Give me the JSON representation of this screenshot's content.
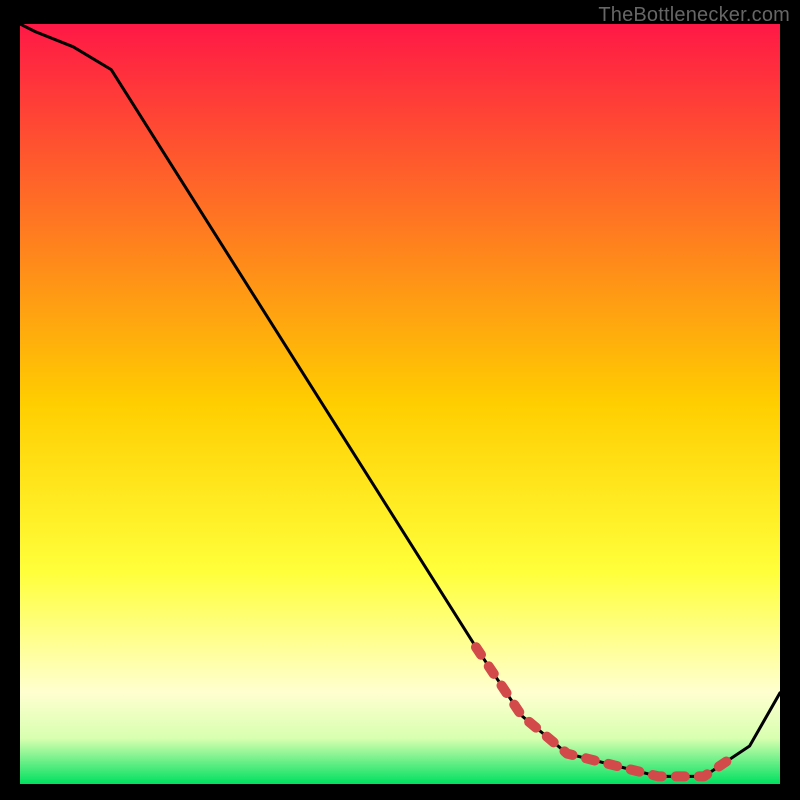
{
  "watermark": "TheBottlenecker.com",
  "chart_data": {
    "type": "line",
    "title": "",
    "xlabel": "",
    "ylabel": "",
    "xlim": [
      0,
      100
    ],
    "ylim": [
      0,
      100
    ],
    "grid": false,
    "legend": false,
    "background_gradient": {
      "stops": [
        {
          "offset": 0.0,
          "color": "#ff1846"
        },
        {
          "offset": 0.5,
          "color": "#ffce00"
        },
        {
          "offset": 0.72,
          "color": "#ffff3a"
        },
        {
          "offset": 0.88,
          "color": "#ffffd0"
        },
        {
          "offset": 0.94,
          "color": "#d8ffb0"
        },
        {
          "offset": 1.0,
          "color": "#00e060"
        }
      ]
    },
    "series": [
      {
        "name": "bottleneck-curve",
        "color": "#000000",
        "x": [
          0,
          2,
          7,
          12,
          60,
          66,
          72,
          84,
          90,
          96,
          100
        ],
        "y": [
          100,
          99,
          97,
          94,
          18,
          9,
          4,
          1,
          1,
          5,
          12
        ]
      },
      {
        "name": "marker-band",
        "color": "#d24a4a",
        "style": "dash-dots",
        "x": [
          60,
          66,
          72,
          84,
          90,
          93
        ],
        "y": [
          18,
          9,
          4,
          1,
          1,
          3
        ]
      }
    ]
  }
}
